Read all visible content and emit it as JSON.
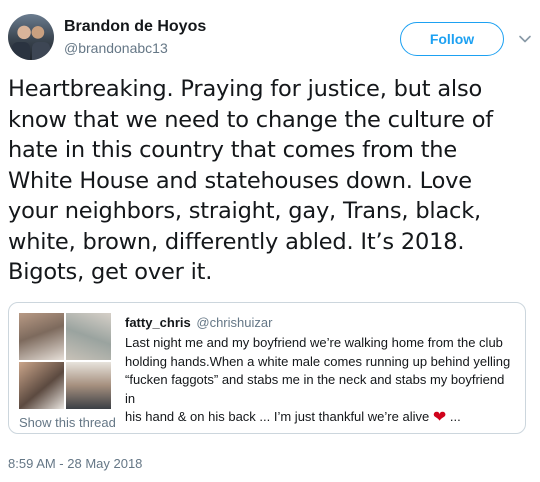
{
  "author": {
    "name": "Brandon de Hoyos",
    "handle": "@brandonabc13",
    "avatar_icon": "profile-photo"
  },
  "follow_label": "Follow",
  "chevron_icon": "chevron-down-icon",
  "tweet": {
    "lines": [
      "Heartbreaking. Praying for justice, but also",
      "know that we need to change the culture of",
      "hate in this country that comes from the",
      "White House and statehouses down. Love",
      "your neighbors, straight, gay, Trans, black,",
      "white, brown, differently abled. It’s 2018.",
      "Bigots, get over it."
    ]
  },
  "quoted": {
    "name": "fatty_chris",
    "handle": "@chrishuizar",
    "lines": [
      "Last night me and my boyfriend we’re walking home from the club",
      "holding hands.When a white male comes running up behind yelling",
      "“fucken faggots” and stabs me in the neck and stabs my boyfriend in",
      "his hand & on his back ... I’m just thankful we’re alive"
    ],
    "ellipsis": " ...",
    "heart_icon": "red-heart-emoji",
    "show_thread": "Show this thread"
  },
  "timestamp": "8:59 AM - 28 May 2018",
  "colors": {
    "accent": "#1da1f2",
    "secondary_text": "#657786",
    "border": "#ccd6dd",
    "heart": "#d0021b"
  }
}
